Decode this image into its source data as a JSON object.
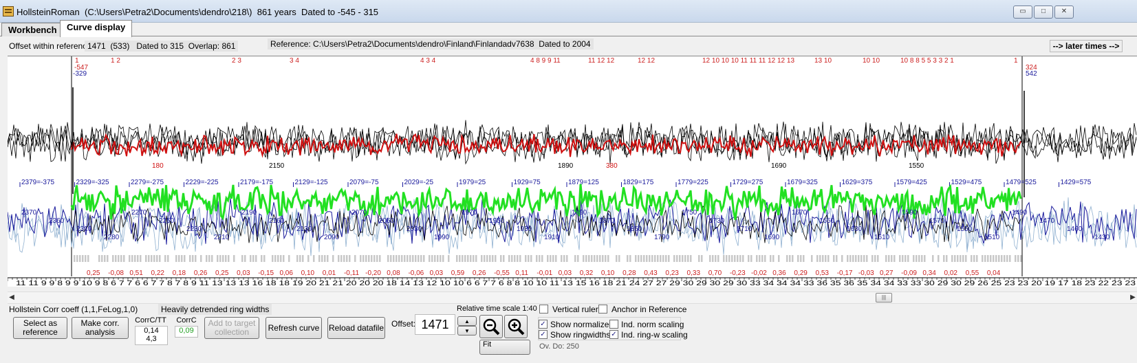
{
  "window": {
    "app_name": "HollsteinRoman",
    "title_info": "  (C:\\Users\\Petra2\\Documents\\dendro\\218\\)  861 years  Dated to -545 - 315",
    "controls": {
      "minimize": "▭",
      "maximize": "□",
      "close": "✕"
    }
  },
  "tabs": [
    {
      "label": "Workbench",
      "active": false
    },
    {
      "label": "Curve display",
      "active": true
    }
  ],
  "info": {
    "offset_label": "Offset within reference:",
    "offset_value": "1471  (533)   Dated to 315  Overlap: 861",
    "reference": "Reference: C:\\Users\\Petra2\\Documents\\dendro\\Finland\\Finlandadv7638  Dated to 2004",
    "later_times": "--> later times -->"
  },
  "plot": {
    "top_counts": [
      {
        "t": "1",
        "c": "red"
      },
      {
        "t": "1 2",
        "c": "red"
      },
      {
        "t": "2 3",
        "c": "red"
      },
      {
        "t": "3 4",
        "c": "red"
      },
      {
        "t": "4 3 4",
        "c": "red"
      },
      {
        "t": "4 8 9 9 11",
        "c": "red"
      },
      {
        "t": "11 12 12",
        "c": "red"
      },
      {
        "t": "12 12",
        "c": "red"
      },
      {
        "t": "12 10 10 10 11 11 11 12 12 13",
        "c": "red"
      },
      {
        "t": "13 10",
        "c": "red"
      },
      {
        "t": "10 10",
        "c": "red"
      },
      {
        "t": "10 8 8 5 5 3 3 2 1",
        "c": "red"
      },
      {
        "t": "1",
        "c": "red"
      }
    ],
    "left_top_red": "-547",
    "left_top_blue": "-329",
    "right_top_red": "324",
    "right_top_blue": "542",
    "upper_inline_labels": [
      "1890",
      "2150",
      "1690",
      "1550",
      "380",
      "180"
    ],
    "mid_scale": [
      "2379=-375",
      "2329=-325",
      "2279=-275",
      "2229=-225",
      "2179=-175",
      "2129=-125",
      "2079=-75",
      "2029=-25",
      "1979=25",
      "1929=75",
      "1879=125",
      "1829=175",
      "1779=225",
      "1729=275",
      "1679=325",
      "1629=375",
      "1579=425",
      "1529=475",
      "1479=525",
      "1429=575"
    ],
    "lower_inline_labels": [
      "2370",
      "2360",
      "2310",
      "2280",
      "2270",
      "2250",
      "2230",
      "2210",
      "2190",
      "2160",
      "2130",
      "2090",
      "2070",
      "2050",
      "2030",
      "1990",
      "1970",
      "1950",
      "1930",
      "1910",
      "1890",
      "1870",
      "1850",
      "1790",
      "1750",
      "1730",
      "1710",
      "1690",
      "1670",
      "1650",
      "1630",
      "1610",
      "1590",
      "1570",
      "1550",
      "1510",
      "1490",
      "1470",
      "1460",
      "1430"
    ],
    "corr_values": [
      "0,25",
      "-0,08",
      "0,51",
      "0,22",
      "0,18",
      "0,26",
      "0,25",
      "0,03",
      "-0,15",
      "0,06",
      "0,10",
      "0,01",
      "-0,11",
      "-0,20",
      "0,08",
      "-0,06",
      "0,03",
      "0,59",
      "0,26",
      "-0,55",
      "0,11",
      "-0,01",
      "0,03",
      "0,32",
      "0,10",
      "0,28",
      "0,43",
      "0,23",
      "0,33",
      "0,70",
      "-0,23",
      "-0,02",
      "0,36",
      "0,29",
      "0,53",
      "-0,17",
      "-0,03",
      "0,27",
      "-0,09",
      "0,34",
      "0,02",
      "0,55",
      "0,04"
    ],
    "bottom_counts": "11 11 9  9 8 9  9 10 9 8 6 7 7 6 6 7  7 8 7 8 9 11 13 13 13 16 18 18 19 20 21 21 20 20 20 18 14 13 12 10 10 6  6 7 7 6 8 8 10 10 11 13 15 16 18 21 24 27 27 29 30 29 30 29 30 33 34 34 34 33 36 35 36 35 34 34 33 33 30 29 30 29 26 25 23 23 20 19 17 18 23 22 23 23"
  },
  "bottom": {
    "method": "Hollstein Corr coeff (1,1,FeLog,1,0)",
    "detrend": "Heavily detrended ring widths",
    "select_ref": "Select as reference",
    "make_corr": "Make corr. analysis",
    "corrc_tt_label": "CorrC/TT",
    "corrc_tt_value1": "0,14",
    "corrc_tt_value2": "4,3",
    "corrc_label": "CorrC",
    "corrc_value": "0,09",
    "add_target": "Add to target collection",
    "refresh": "Refresh curve",
    "reload": "Reload datafile",
    "offset_label": "Offset:",
    "offset_value": "1471",
    "relative_scale": "Relative time scale 1:40",
    "fit_label": "Fit",
    "checkboxes": [
      {
        "label": "Vertical rulers",
        "checked": false
      },
      {
        "label": "Anchor in Reference",
        "checked": false
      },
      {
        "label": "Show normalized",
        "checked": true
      },
      {
        "label": "Ind. norm scaling",
        "checked": false
      },
      {
        "label": "Show ringwidths",
        "checked": true
      },
      {
        "label": "Ind. ring-w scaling",
        "checked": true
      }
    ],
    "truncated_text": "Ov. Do: 250"
  },
  "colors": {
    "sample_red": "#d01010",
    "reference_blue": "#1a1a9c",
    "corr_green": "#22e022",
    "count_red": "#cc2020",
    "light_blue": "#8fb0d0"
  }
}
